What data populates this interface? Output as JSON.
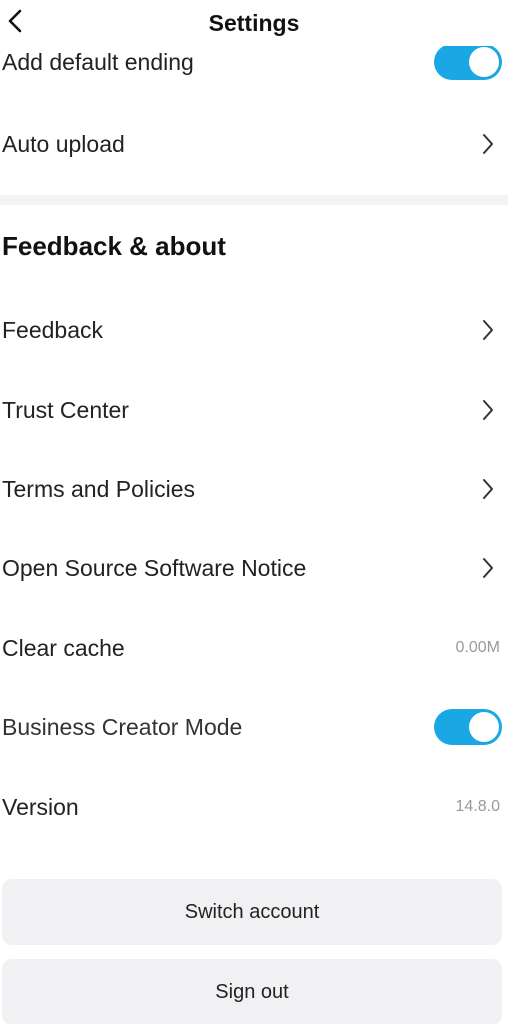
{
  "header": {
    "title": "Settings"
  },
  "top_rows": {
    "add_default_ending": {
      "label": "Add default ending",
      "toggle_on": true
    },
    "auto_upload": {
      "label": "Auto upload"
    }
  },
  "section": {
    "title": "Feedback & about"
  },
  "items": {
    "feedback": "Feedback",
    "trust_center": "Trust Center",
    "terms": "Terms and Policies",
    "open_source": "Open Source Software Notice",
    "clear_cache": {
      "label": "Clear cache",
      "value": "0.00M"
    },
    "business_mode": {
      "label": "Business Creator Mode",
      "toggle_on": true
    },
    "version": {
      "label": "Version",
      "value": "14.8.0"
    }
  },
  "buttons": {
    "switch_account": "Switch account",
    "sign_out": "Sign out"
  },
  "colors": {
    "toggle_on": "#19a8e4",
    "divider": "#f3f4f6",
    "button_bg": "#f1f1f3"
  },
  "icons": {
    "back": "chevron-left-icon",
    "row_arrow": "chevron-right-icon"
  }
}
